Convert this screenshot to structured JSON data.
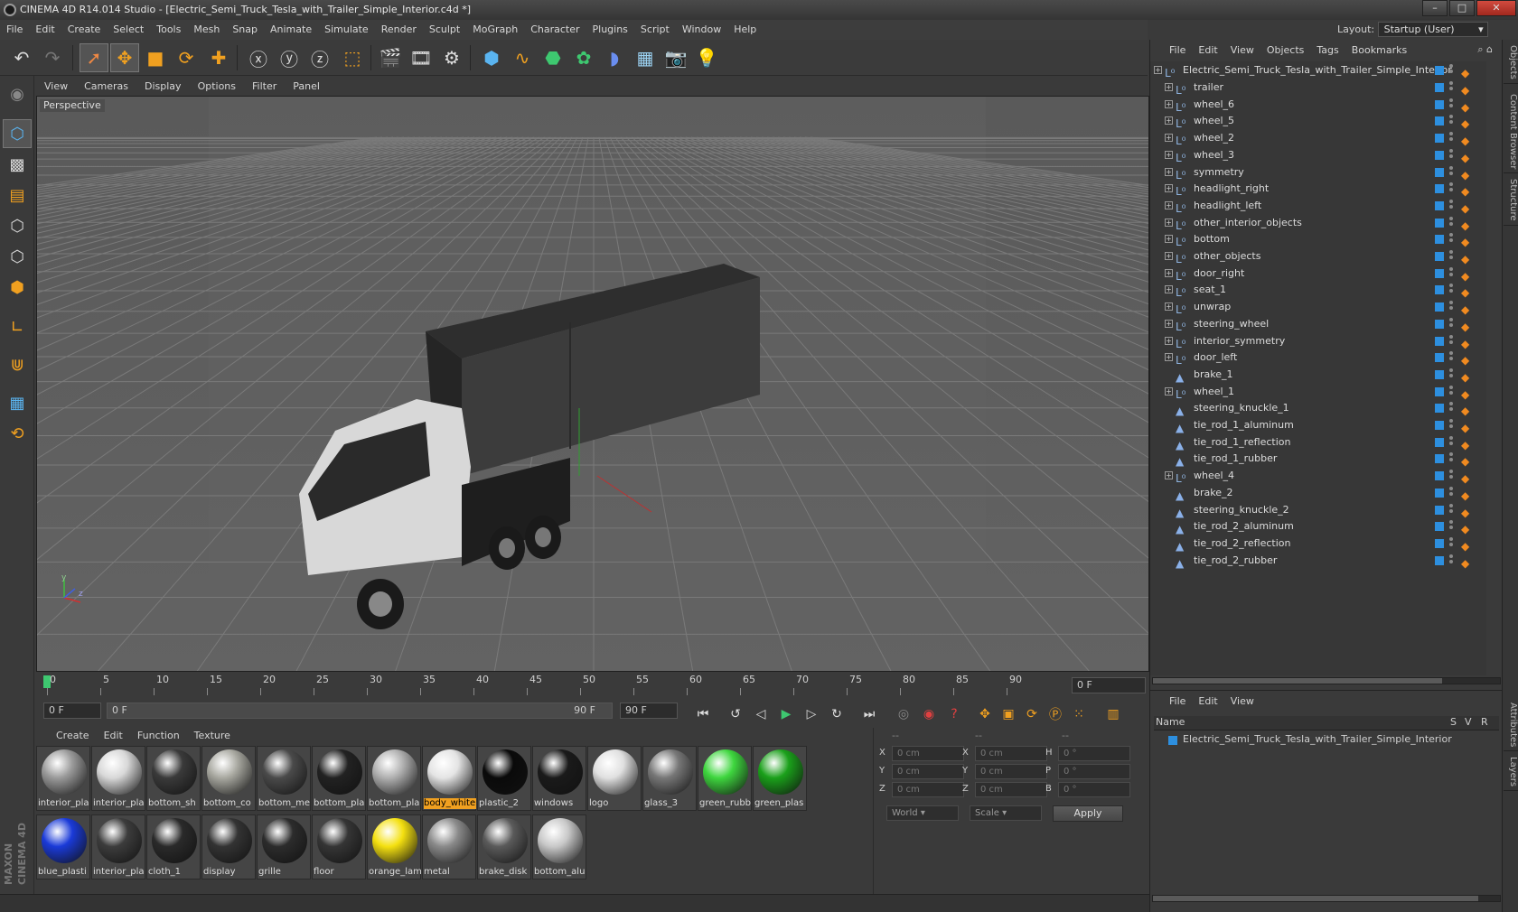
{
  "window": {
    "title": "CINEMA 4D R14.014 Studio - [Electric_Semi_Truck_Tesla_with_Trailer_Simple_Interior.c4d *]",
    "controls": [
      "–",
      "□",
      "✕"
    ]
  },
  "menu": [
    "File",
    "Edit",
    "Create",
    "Select",
    "Tools",
    "Mesh",
    "Snap",
    "Animate",
    "Simulate",
    "Render",
    "Sculpt",
    "MoGraph",
    "Character",
    "Plugins",
    "Script",
    "Window",
    "Help"
  ],
  "layout": {
    "label": "Layout:",
    "value": "Startup (User)"
  },
  "viewport": {
    "menu": [
      "View",
      "Cameras",
      "Display",
      "Options",
      "Filter",
      "Panel"
    ],
    "label": "Perspective",
    "axis": {
      "y": "y",
      "z": "z"
    }
  },
  "timeline": {
    "ticks": [
      "0",
      "5",
      "10",
      "15",
      "20",
      "25",
      "30",
      "35",
      "40",
      "45",
      "50",
      "55",
      "60",
      "65",
      "70",
      "75",
      "80",
      "85",
      "90"
    ],
    "current_frame": "0 F",
    "start_frame": "0 F",
    "range_start": "0 F",
    "range_end": "90 F",
    "end_frame": "90 F"
  },
  "materials": {
    "menu": [
      "Create",
      "Edit",
      "Function",
      "Texture"
    ],
    "items": [
      {
        "label": "interior_pla",
        "color": "#9a9a9a"
      },
      {
        "label": "interior_pla",
        "color": "#d8d8d8"
      },
      {
        "label": "bottom_sh",
        "color": "#3a3a3a"
      },
      {
        "label": "bottom_co",
        "color": "#a8a8a0"
      },
      {
        "label": "bottom_me",
        "color": "#4a4a4a"
      },
      {
        "label": "bottom_pla",
        "color": "#222222"
      },
      {
        "label": "bottom_pla",
        "color": "#b0b0b0"
      },
      {
        "label": "body_white",
        "color": "#e4e4e4",
        "highlight": true
      },
      {
        "label": "plastic_2",
        "color": "#0a0a0a"
      },
      {
        "label": "windows",
        "color": "#1a1a1a"
      },
      {
        "label": "logo",
        "color": "#e0e0e0"
      },
      {
        "label": "glass_3",
        "color": "#777777"
      },
      {
        "label": "green_rubb",
        "color": "#3ed63e"
      },
      {
        "label": "green_plas",
        "color": "#1aa01a"
      },
      {
        "label": "blue_plasti",
        "color": "#1a3ad8"
      },
      {
        "label": "interior_pla",
        "color": "#3c3c3c"
      },
      {
        "label": "cloth_1",
        "color": "#2a2a2a"
      },
      {
        "label": "display",
        "color": "#333333"
      },
      {
        "label": "grille",
        "color": "#2c2c2c"
      },
      {
        "label": "floor",
        "color": "#353535"
      },
      {
        "label": "orange_lam",
        "color": "#f4e010"
      },
      {
        "label": "metal",
        "color": "#8a8a8a"
      },
      {
        "label": "brake_disk",
        "color": "#5a5a5a"
      },
      {
        "label": "bottom_alu",
        "color": "#c8c8c8"
      }
    ]
  },
  "coordinates": {
    "header": [
      "--",
      "--",
      "--"
    ],
    "rows": [
      {
        "a": "X",
        "av": "0 cm",
        "b": "X",
        "bv": "0 cm",
        "c": "H",
        "cv": "0 °"
      },
      {
        "a": "Y",
        "av": "0 cm",
        "b": "Y",
        "bv": "0 cm",
        "c": "P",
        "cv": "0 °"
      },
      {
        "a": "Z",
        "av": "0 cm",
        "b": "Z",
        "bv": "0 cm",
        "c": "B",
        "cv": "0 °"
      }
    ],
    "mode": "World",
    "scale": "Scale",
    "apply": "Apply"
  },
  "objects": {
    "menu": [
      "File",
      "Edit",
      "View",
      "Objects",
      "Tags",
      "Bookmarks"
    ],
    "root": "Electric_Semi_Truck_Tesla_with_Trailer_Simple_Interior",
    "items": [
      {
        "name": "trailer",
        "type": "null",
        "expand": true
      },
      {
        "name": "wheel_6",
        "type": "null",
        "expand": true
      },
      {
        "name": "wheel_5",
        "type": "null",
        "expand": true
      },
      {
        "name": "wheel_2",
        "type": "null",
        "expand": true
      },
      {
        "name": "wheel_3",
        "type": "null",
        "expand": true
      },
      {
        "name": "symmetry",
        "type": "null",
        "expand": true
      },
      {
        "name": "headlight_right",
        "type": "null",
        "expand": true
      },
      {
        "name": "headlight_left",
        "type": "null",
        "expand": true
      },
      {
        "name": "other_interior_objects",
        "type": "null",
        "expand": true
      },
      {
        "name": "bottom",
        "type": "null",
        "expand": true
      },
      {
        "name": "other_objects",
        "type": "null",
        "expand": true
      },
      {
        "name": "door_right",
        "type": "null",
        "expand": true
      },
      {
        "name": "seat_1",
        "type": "null",
        "expand": true
      },
      {
        "name": "unwrap",
        "type": "null",
        "expand": true
      },
      {
        "name": "steering_wheel",
        "type": "null",
        "expand": true
      },
      {
        "name": "interior_symmetry",
        "type": "null",
        "expand": true
      },
      {
        "name": "door_left",
        "type": "null",
        "expand": true
      },
      {
        "name": "brake_1",
        "type": "mesh",
        "expand": false
      },
      {
        "name": "wheel_1",
        "type": "null",
        "expand": true
      },
      {
        "name": "steering_knuckle_1",
        "type": "mesh",
        "expand": false
      },
      {
        "name": "tie_rod_1_aluminum",
        "type": "mesh",
        "expand": false
      },
      {
        "name": "tie_rod_1_reflection",
        "type": "mesh",
        "expand": false
      },
      {
        "name": "tie_rod_1_rubber",
        "type": "mesh",
        "expand": false
      },
      {
        "name": "wheel_4",
        "type": "null",
        "expand": true
      },
      {
        "name": "brake_2",
        "type": "mesh",
        "expand": false
      },
      {
        "name": "steering_knuckle_2",
        "type": "mesh",
        "expand": false
      },
      {
        "name": "tie_rod_2_aluminum",
        "type": "mesh",
        "expand": false
      },
      {
        "name": "tie_rod_2_reflection",
        "type": "mesh",
        "expand": false
      },
      {
        "name": "tie_rod_2_rubber",
        "type": "mesh",
        "expand": false
      }
    ]
  },
  "layers": {
    "menu": [
      "File",
      "Edit",
      "View"
    ],
    "columns": {
      "name": "Name",
      "s": "S",
      "v": "V",
      "r": "R"
    },
    "row": "Electric_Semi_Truck_Tesla_with_Trailer_Simple_Interior"
  },
  "side_tabs": [
    "Objects",
    "Content Browser",
    "Structure",
    "Attributes",
    "Layers"
  ],
  "brand": {
    "top": "MAXON",
    "bottom": "CINEMA 4D"
  },
  "colors": {
    "accent": "#f0a020",
    "select_blue": "#2d8fdf",
    "bg": "#3a3a3a"
  }
}
